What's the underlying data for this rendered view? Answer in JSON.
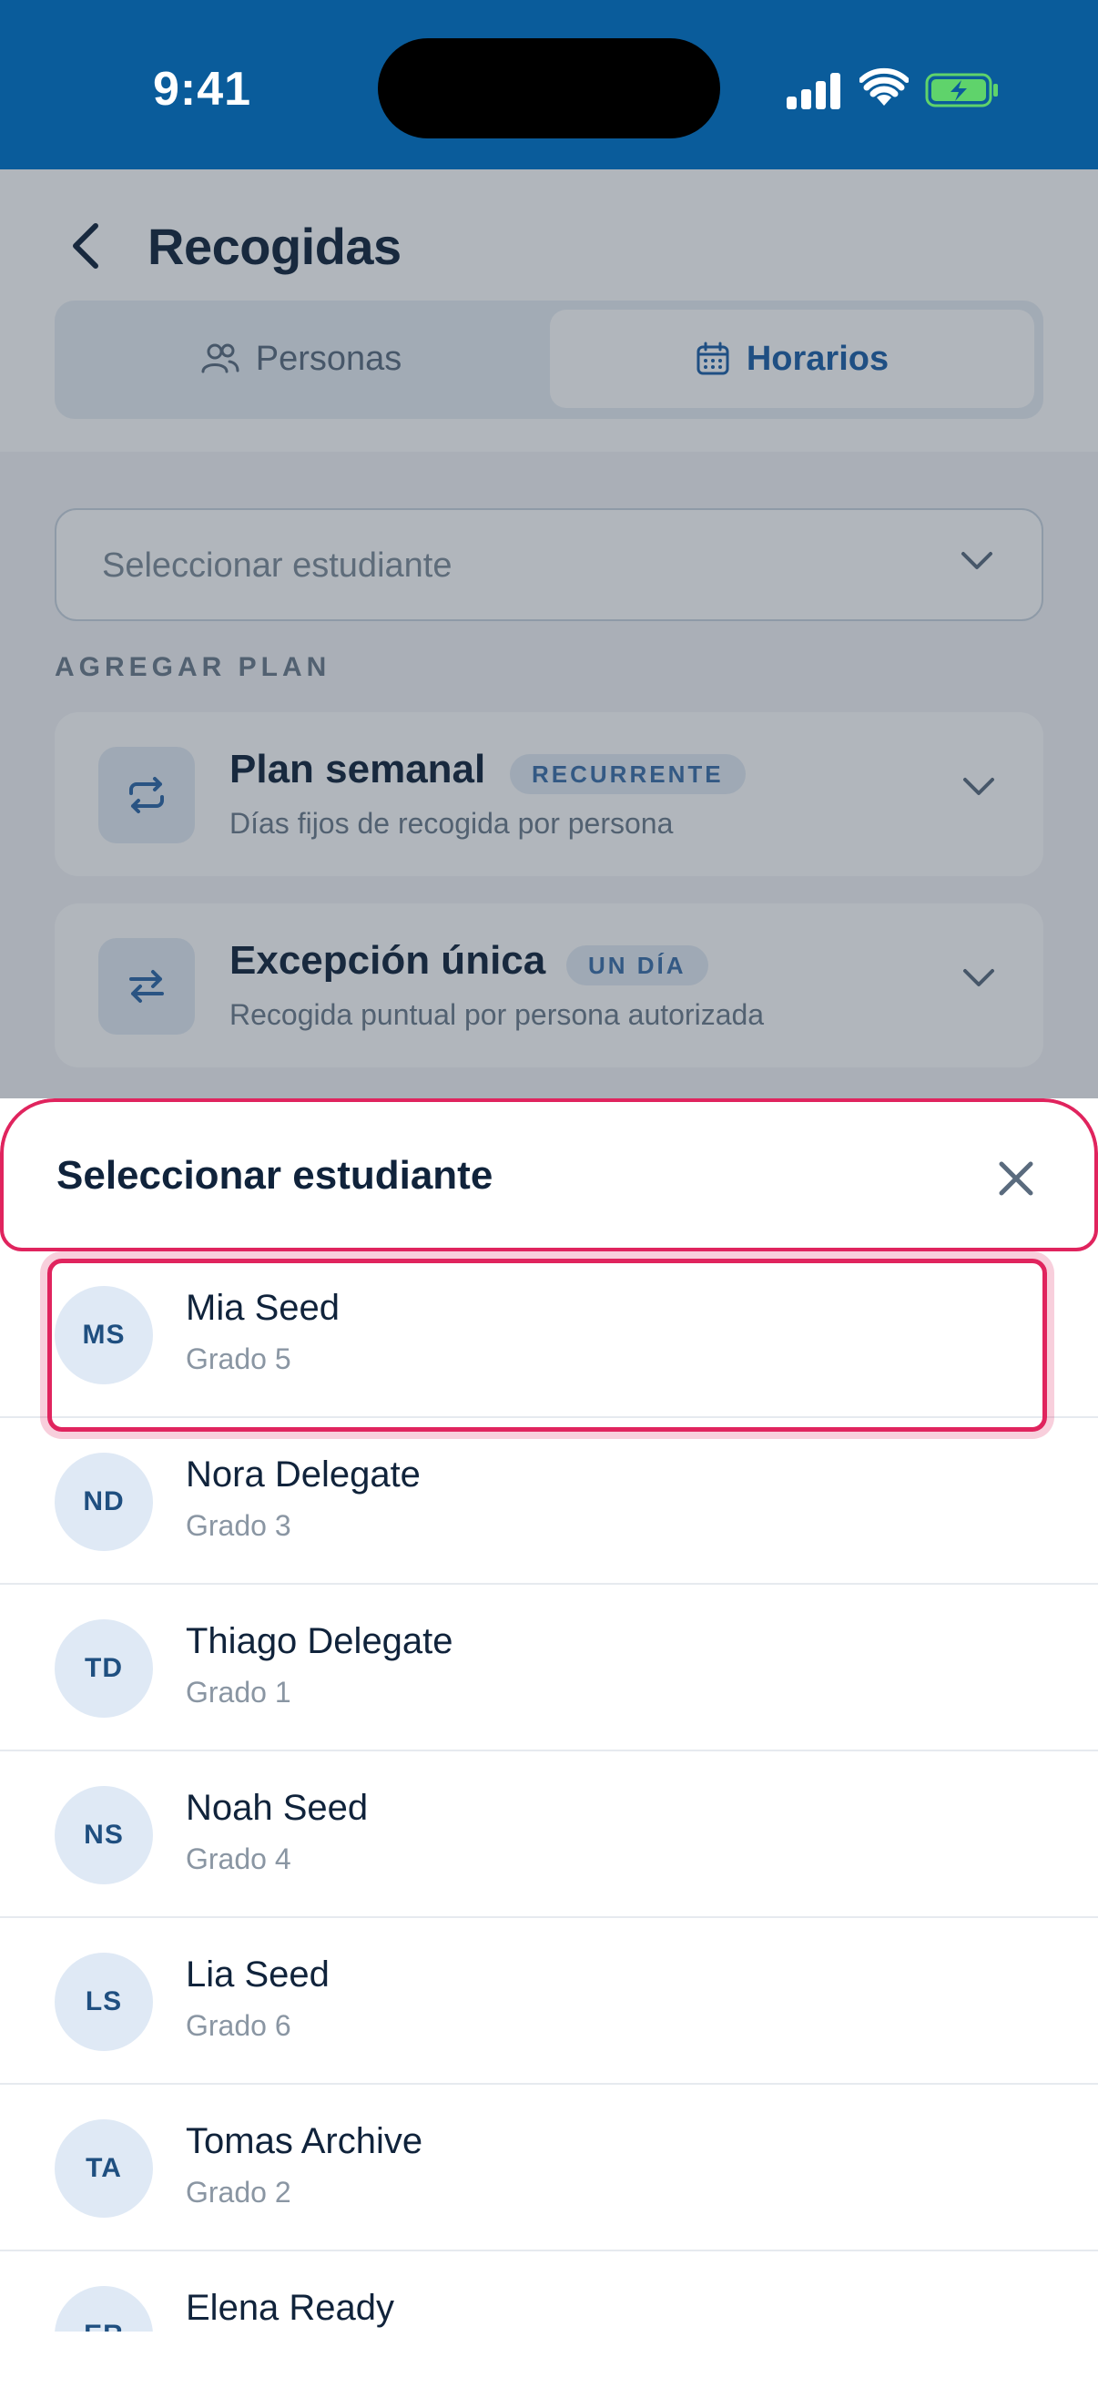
{
  "status_bar": {
    "time": "9:41"
  },
  "header": {
    "title": "Recogidas",
    "tabs": [
      {
        "label": "Personas",
        "icon": "people-icon",
        "active": false
      },
      {
        "label": "Horarios",
        "icon": "calendar-icon",
        "active": true
      }
    ]
  },
  "student_select": {
    "placeholder": "Seleccionar estudiante"
  },
  "add_plan": {
    "section_label": "AGREGAR PLAN",
    "cards": [
      {
        "title": "Plan semanal",
        "badge": "RECURRENTE",
        "subtitle": "Días fijos de recogida por persona",
        "icon": "repeat-icon"
      },
      {
        "title": "Excepción única",
        "badge": "UN DÍA",
        "subtitle": "Recogida puntual por persona autorizada",
        "icon": "swap-arrows-icon"
      }
    ]
  },
  "sheet": {
    "title": "Seleccionar estudiante",
    "students": [
      {
        "initials": "MS",
        "name": "Mia Seed",
        "grade": "Grado 5"
      },
      {
        "initials": "ND",
        "name": "Nora Delegate",
        "grade": "Grado 3"
      },
      {
        "initials": "TD",
        "name": "Thiago Delegate",
        "grade": "Grado 1"
      },
      {
        "initials": "NS",
        "name": "Noah Seed",
        "grade": "Grado 4"
      },
      {
        "initials": "LS",
        "name": "Lia Seed",
        "grade": "Grado 6"
      },
      {
        "initials": "TA",
        "name": "Tomas Archive",
        "grade": "Grado 2"
      },
      {
        "initials": "ER",
        "name": "Elena Ready",
        "grade": ""
      }
    ]
  },
  "colors": {
    "brand": "#0a5c9b",
    "highlight": "#e0245e",
    "accent": "#1b5fa6"
  }
}
